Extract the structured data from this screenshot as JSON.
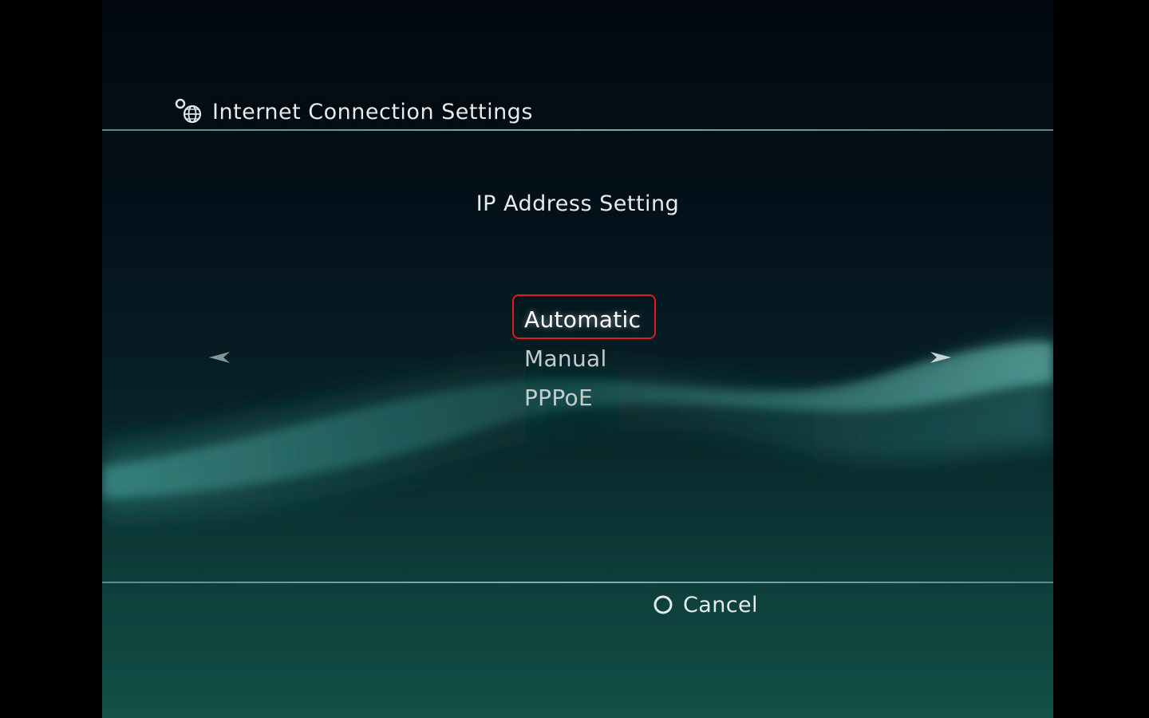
{
  "header": {
    "title": "Internet Connection Settings",
    "icon": "network-globe-icon"
  },
  "dialog": {
    "subtitle": "IP Address Setting",
    "options": [
      {
        "label": "Automatic",
        "selected": true
      },
      {
        "label": "Manual",
        "selected": false
      },
      {
        "label": "PPPoE",
        "selected": false
      }
    ]
  },
  "navigation": {
    "left_icon": "arrow-left-icon",
    "right_icon": "arrow-right-icon"
  },
  "footer": {
    "cancel_icon": "circle-button-icon",
    "cancel_label": "Cancel"
  },
  "colors": {
    "highlight_border": "#e01b1b",
    "text": "#e6ecec",
    "background_top": "#03080f",
    "background_bottom": "#125048"
  }
}
